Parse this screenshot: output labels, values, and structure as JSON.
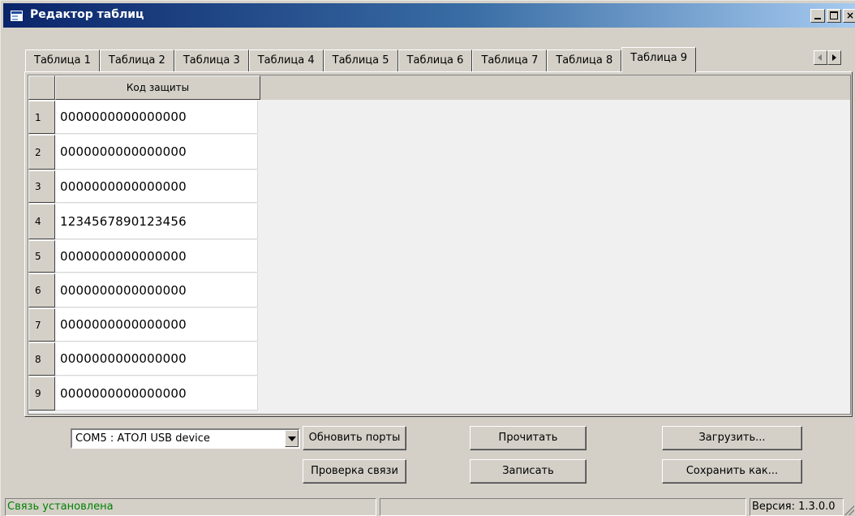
{
  "window": {
    "title": "Редактор таблиц"
  },
  "tabs": [
    {
      "label": "Таблица 1"
    },
    {
      "label": "Таблица 2"
    },
    {
      "label": "Таблица 3"
    },
    {
      "label": "Таблица 4"
    },
    {
      "label": "Таблица 5"
    },
    {
      "label": "Таблица 6"
    },
    {
      "label": "Таблица 7"
    },
    {
      "label": "Таблица 8"
    },
    {
      "label": "Таблица 9"
    }
  ],
  "active_tab": "Таблица 9",
  "table": {
    "column_header": "Код защиты",
    "rows": [
      {
        "num": "1",
        "value": "0000000000000000"
      },
      {
        "num": "2",
        "value": "0000000000000000"
      },
      {
        "num": "3",
        "value": "0000000000000000"
      },
      {
        "num": "4",
        "value": "1234567890123456"
      },
      {
        "num": "5",
        "value": "0000000000000000"
      },
      {
        "num": "6",
        "value": "0000000000000000"
      },
      {
        "num": "7",
        "value": "0000000000000000"
      },
      {
        "num": "8",
        "value": "0000000000000000"
      },
      {
        "num": "9",
        "value": "0000000000000000"
      }
    ]
  },
  "controls": {
    "port_select": "COM5 : АТОЛ USB device",
    "refresh_ports": "Обновить порты",
    "check_connection": "Проверка связи",
    "read": "Прочитать",
    "write": "Записать",
    "load": "Загрузить...",
    "save_as": "Сохранить как..."
  },
  "status": {
    "connection": "Связь установлена",
    "version": "Версия: 1.3.0.0"
  },
  "colors": {
    "status_ok": "#008000",
    "title_bar": "#0a246a",
    "window_bg": "#d4d0c8"
  }
}
